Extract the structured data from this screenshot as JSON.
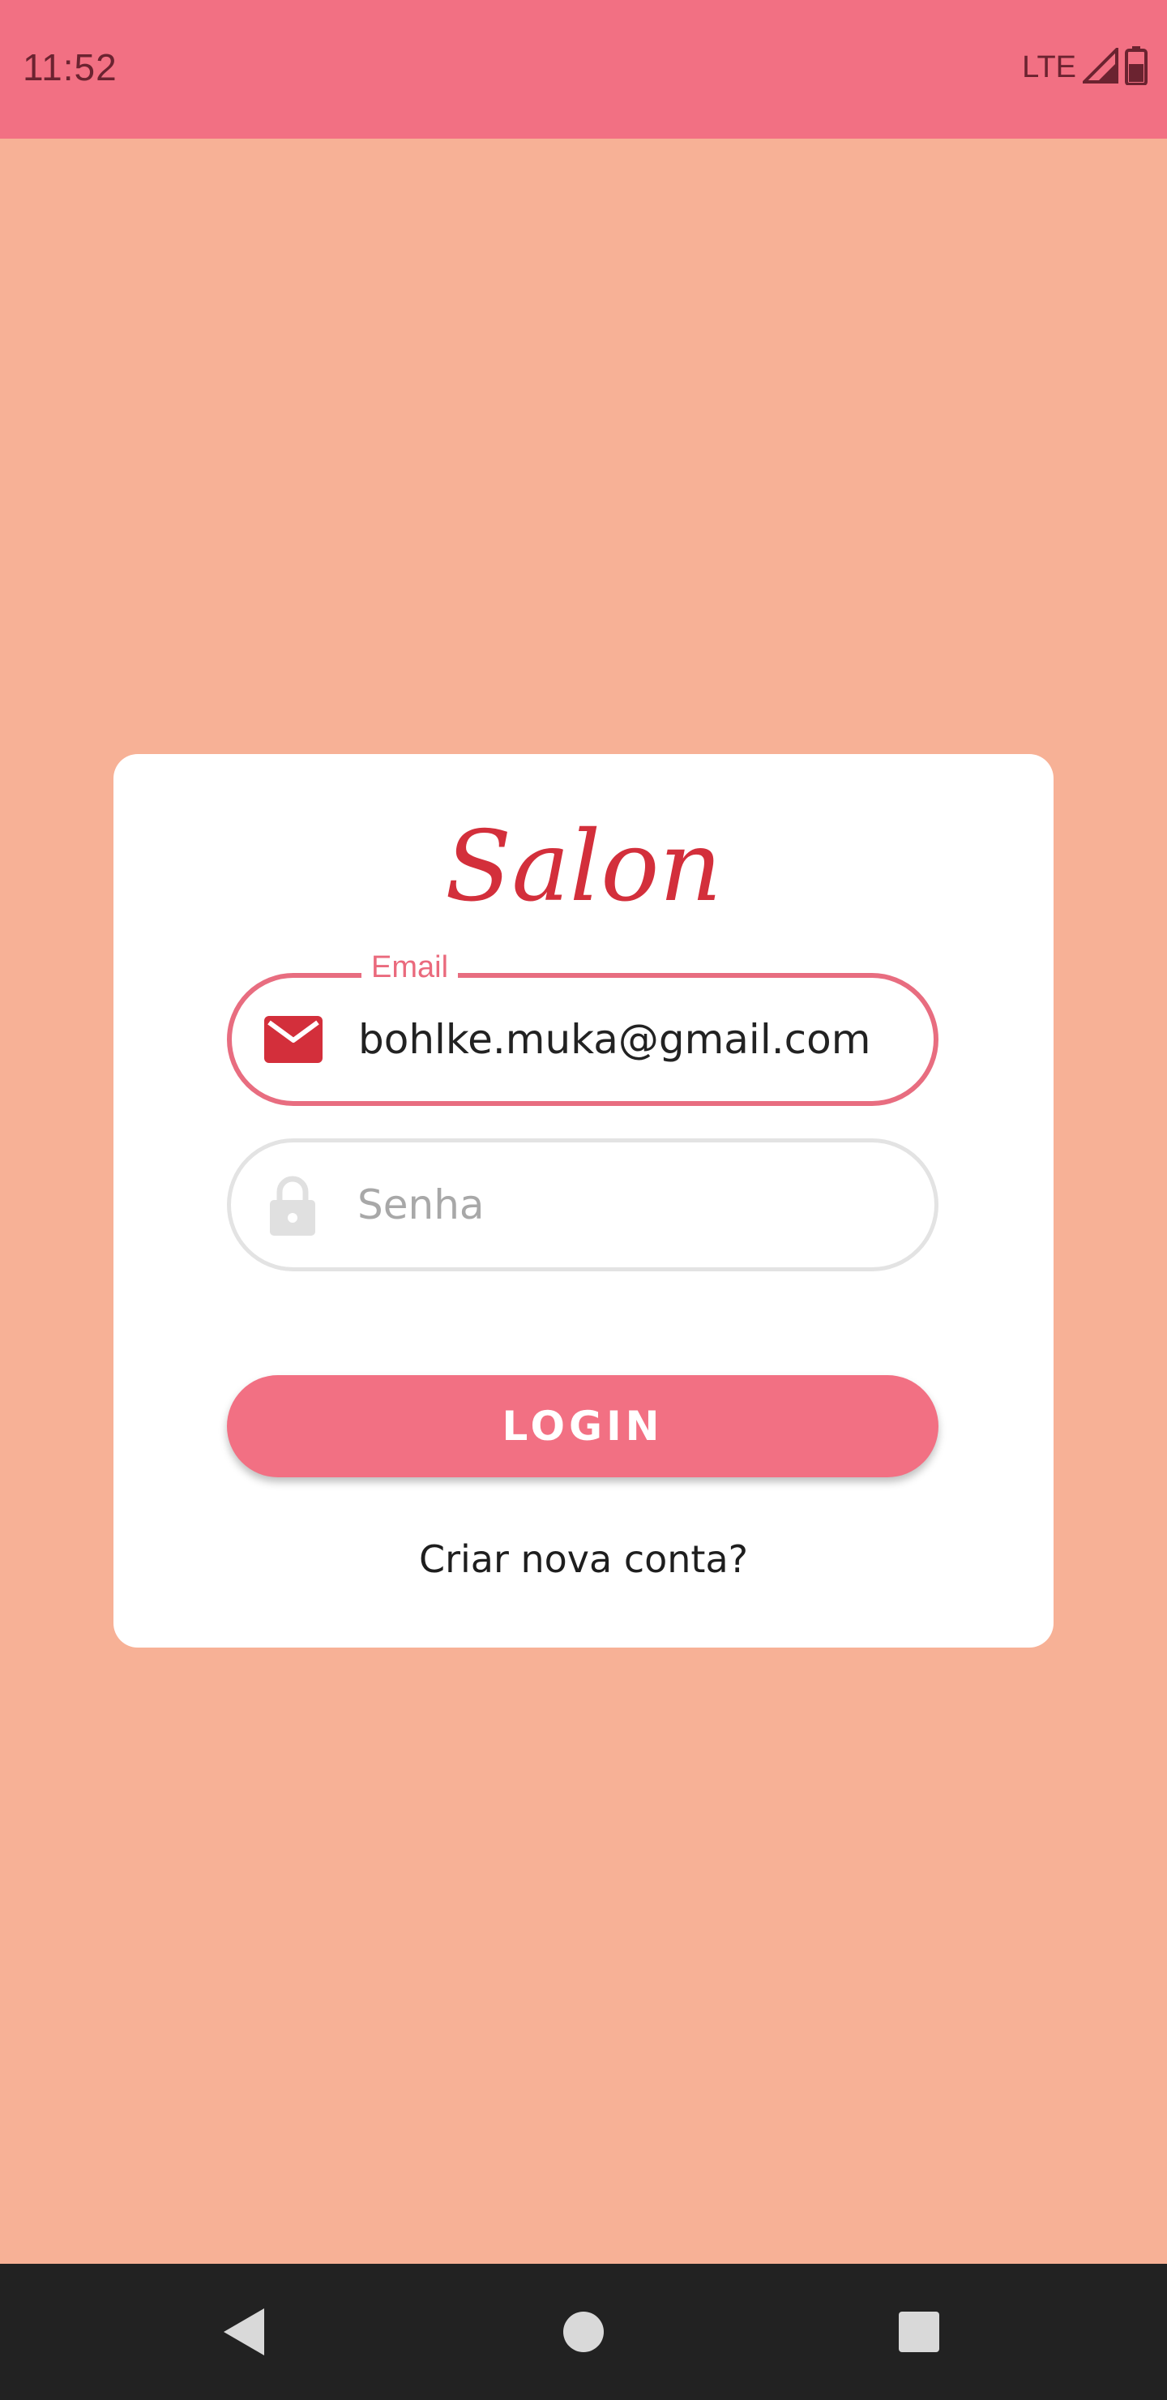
{
  "status_bar": {
    "time": "11:52",
    "network": "LTE",
    "icons": [
      "signal-icon",
      "battery-icon"
    ]
  },
  "login_card": {
    "brand": "Salon",
    "email": {
      "label": "Email",
      "value": "bohlke.muka@gmail.com",
      "icon": "mail-icon"
    },
    "password": {
      "placeholder": "Senha",
      "value": "",
      "icon": "lock-icon"
    },
    "login_button": "LOGIN",
    "create_account_link": "Criar nova conta?"
  },
  "nav_bar": {
    "icons": [
      "back-icon",
      "home-icon",
      "recents-icon"
    ]
  },
  "colors": {
    "status_bar": "#f27083",
    "background": "#f7b196",
    "brand": "#d32f3b",
    "accent": "#f27083",
    "nav_bar": "#222222"
  }
}
